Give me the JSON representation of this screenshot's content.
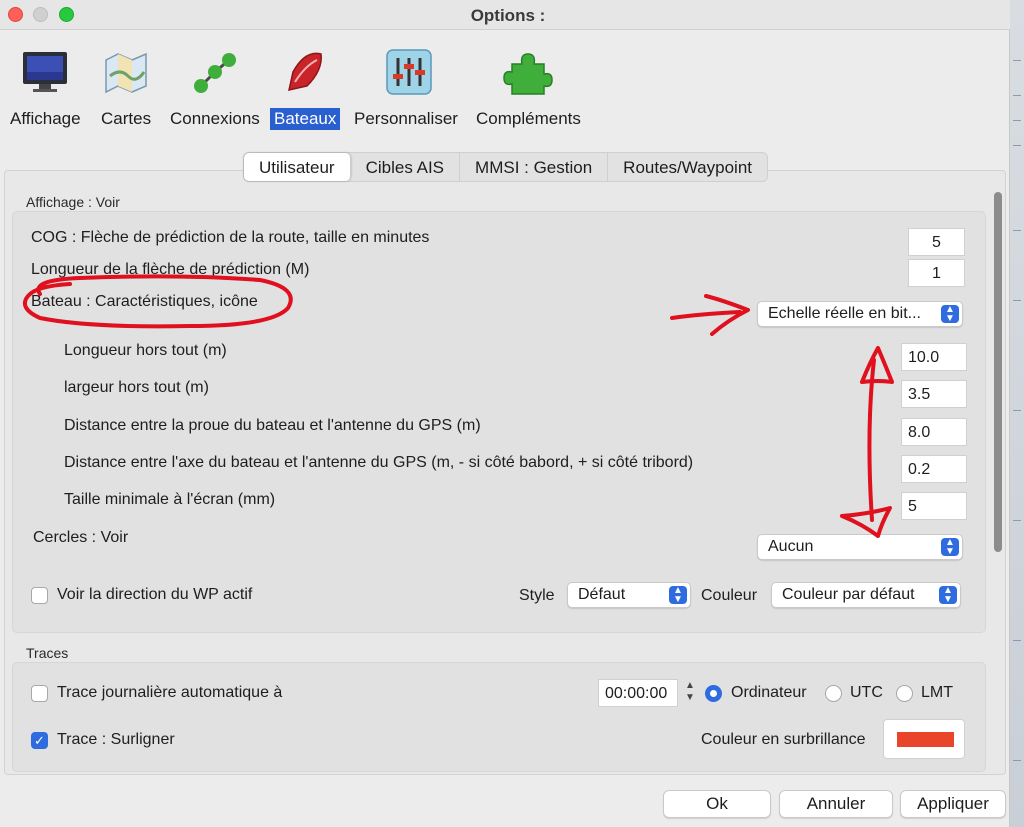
{
  "window": {
    "title": "Options :"
  },
  "toolbar": [
    {
      "label": "Affichage",
      "icon": "monitor-icon"
    },
    {
      "label": "Cartes",
      "icon": "charts-icon"
    },
    {
      "label": "Connexions",
      "icon": "connections-icon"
    },
    {
      "label": "Bateaux",
      "icon": "boat-icon",
      "active": true
    },
    {
      "label": "Personnaliser",
      "icon": "sliders-icon"
    },
    {
      "label": "Compléments",
      "icon": "puzzle-icon"
    }
  ],
  "tabs": [
    {
      "label": "Utilisateur",
      "selected": true
    },
    {
      "label": "Cibles AIS"
    },
    {
      "label": "MMSI : Gestion"
    },
    {
      "label": "Routes/Waypoint"
    }
  ],
  "display_group": {
    "title": "Affichage : Voir",
    "cog_label": "COG : Flèche de prédiction de la route, taille en minutes",
    "cog_value": "5",
    "pred_length_label": "Longueur de la flèche de prédiction (M)",
    "pred_length_value": "1",
    "ship_label": "Bateau : Caractéristiques, icône",
    "ship_icon_select": "Echelle réelle en bit...",
    "loa_label": "Longueur hors tout (m)",
    "loa_value": "10.0",
    "beam_label": "largeur hors tout (m)",
    "beam_value": "3.5",
    "gps_bow_label": "Distance entre la proue du bateau et l'antenne du GPS (m)",
    "gps_bow_value": "8.0",
    "gps_axis_label": "Distance entre l'axe du bateau et l'antenne du GPS (m, - si côté babord, + si côté tribord)",
    "gps_axis_value": "0.2",
    "min_size_label": "Taille minimale à l'écran (mm)",
    "min_size_value": "5",
    "circles_label": "Cercles : Voir",
    "circles_select": "Aucun",
    "wp_dir_label": "Voir la direction du WP actif",
    "wp_dir_checked": false,
    "style_label": "Style",
    "style_select": "Défaut",
    "color_label": "Couleur",
    "color_select": "Couleur par défaut"
  },
  "traces_group": {
    "title": "Traces",
    "daily_label": "Trace journalière automatique à",
    "daily_checked": false,
    "daily_time": "00:00:00",
    "radio_computer": "Ordinateur",
    "radio_utc": "UTC",
    "radio_lmt": "LMT",
    "highlight_label": "Trace : Surligner",
    "highlight_checked": true,
    "highlight_color_label": "Couleur en surbrillance",
    "highlight_color": "#e8452a"
  },
  "buttons": {
    "ok": "Ok",
    "cancel": "Annuler",
    "apply": "Appliquer"
  },
  "colors": {
    "accent": "#2f6ce0",
    "annotation": "#e0101e"
  }
}
